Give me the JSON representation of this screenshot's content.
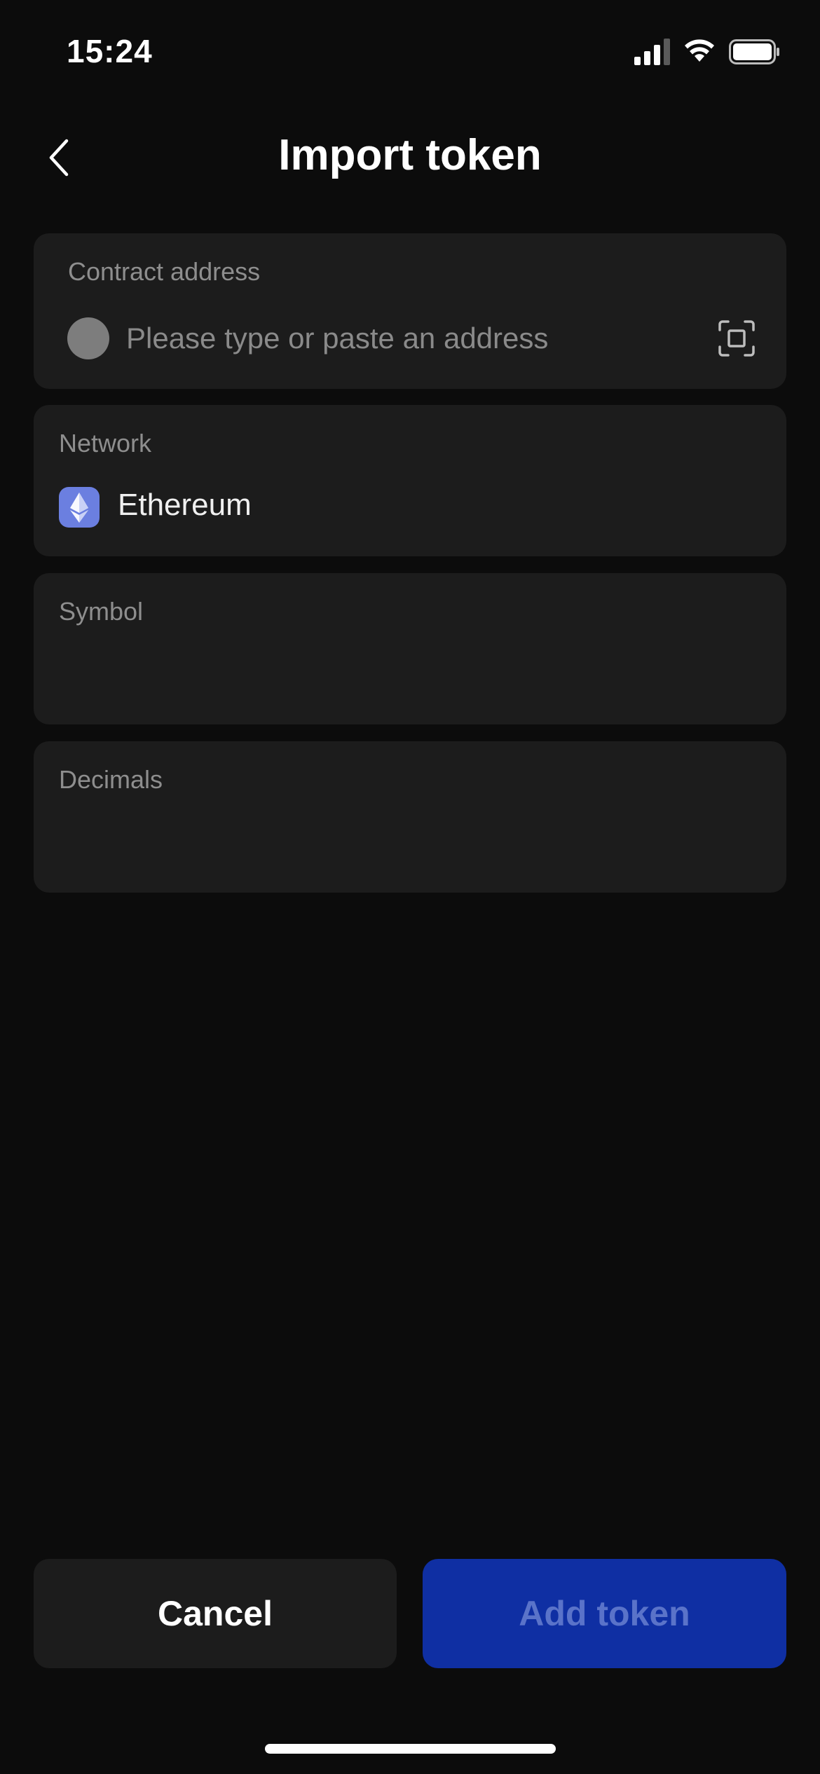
{
  "status_bar": {
    "time": "15:24"
  },
  "header": {
    "title": "Import token",
    "back_icon": "chevron-left-icon"
  },
  "contract_address": {
    "label": "Contract address",
    "placeholder": "Please type or paste an address",
    "value": "",
    "scan_icon": "scan-icon"
  },
  "network": {
    "label": "Network",
    "value": "Ethereum",
    "icon": "ethereum-icon",
    "icon_color": "#6b7fe0"
  },
  "symbol": {
    "label": "Symbol",
    "value": ""
  },
  "decimals": {
    "label": "Decimals",
    "value": ""
  },
  "actions": {
    "cancel_label": "Cancel",
    "add_label": "Add token"
  },
  "colors": {
    "background": "#0c0c0c",
    "card": "#1c1c1c",
    "primary_button": "#0f2fa3",
    "primary_button_text_disabled": "#5a73c9",
    "muted_text": "#8e8e8e"
  }
}
